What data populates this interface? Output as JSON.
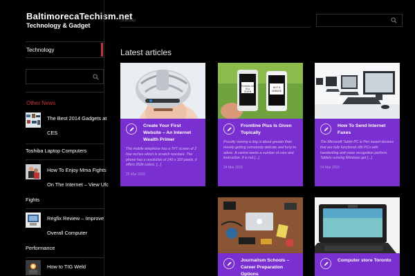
{
  "site": {
    "title": "BaltimorecaTechism.net",
    "tagline": "Technology & Gadget",
    "sitemap_label": "Sitemap"
  },
  "sidebar": {
    "category_label": "Technology",
    "other_news_label": "Other News",
    "news": [
      {
        "line1": "The Best 2014 Gadgets at",
        "line2": "CES",
        "line3": "",
        "thumb": true
      },
      {
        "line1": "Toshiba Laptop Computers",
        "line2": "",
        "line3": "",
        "thumb": false
      },
      {
        "line1": "How To Enjoy Mma Fights",
        "line2": "On The Internet – View Ufc",
        "line3": "Fights",
        "thumb": true
      },
      {
        "line1": "Regfix Review – Improve",
        "line2": "Overall Computer",
        "line3": "Performance",
        "thumb": true
      },
      {
        "line1": "How to TIG Weld",
        "line2": "",
        "line3": "",
        "thumb": true
      }
    ]
  },
  "main": {
    "heading": "Latest articles",
    "articles": [
      {
        "title": "Create Your First Website – An Internet Wealth Primer",
        "excerpt": "The mobile telephone has a TFT screen of 2 four inches which is scratch resistant. The phone has a resolution of 240 x 320 pixels, it offers 262k colors. [...]",
        "date": "25 Mar 2015",
        "image": "massage-helmet"
      },
      {
        "title": "Frontline Plus Is Given Topically",
        "excerpt": "Proudly owning a dog is about greater than merely getting somebody delicate and furry to adore. A canine wants a number of care and instruction. It is not [...]",
        "date": "24 Mar 2015",
        "image": "two-phones"
      },
      {
        "title": "How To Send Internet Faxes",
        "excerpt": "The Microsoft Tablet PC is Pen based devices that are fully functional x86 PCs with handwriting and voice recognition perform. Tablets running Windows get [...]",
        "date": "24 Mar 2015",
        "image": "computer-lab"
      },
      {
        "title": "Journalism Schools – Career Preparation Options",
        "excerpt": "",
        "date": "",
        "image": "desk-gadgets"
      },
      {
        "title": "Computer store Toronto",
        "excerpt": "",
        "date": "",
        "image": "netbook"
      }
    ]
  },
  "colors": {
    "background": "#000000",
    "card_purple": "#7a2fd0",
    "accent_red": "#c5343c"
  },
  "icons": {
    "search": "search-icon",
    "pencil": "pencil-icon"
  }
}
